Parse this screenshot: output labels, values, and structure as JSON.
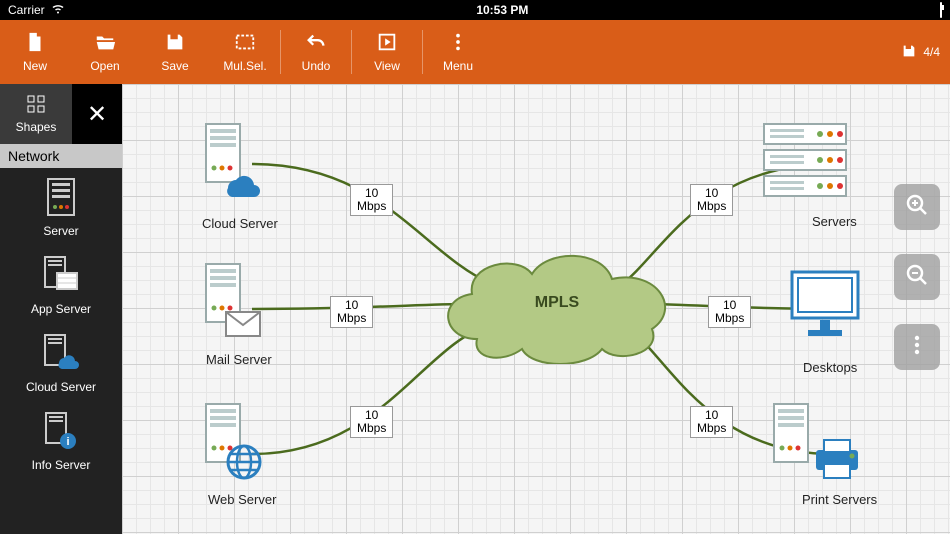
{
  "status": {
    "carrier": "Carrier",
    "time": "10:53 PM"
  },
  "toolbar": {
    "new": "New",
    "open": "Open",
    "save": "Save",
    "mulsel": "Mul.Sel.",
    "undo": "Undo",
    "view": "View",
    "menu": "Menu",
    "page_indicator": "4/4"
  },
  "sidebar": {
    "shapes_label": "Shapes",
    "category": "Network",
    "items": [
      {
        "label": "Server"
      },
      {
        "label": "App Server"
      },
      {
        "label": "Cloud Server"
      },
      {
        "label": "Info Server"
      }
    ]
  },
  "diagram": {
    "center_label": "MPLS",
    "nodes": {
      "cloud_server": "Cloud Server",
      "mail_server": "Mail Server",
      "web_server": "Web Server",
      "servers": "Servers",
      "desktops": "Desktops",
      "print_servers": "Print Servers"
    },
    "rates": {
      "r1": "10\nMbps",
      "r2": "10\nMbps",
      "r3": "10\nMbps",
      "r4": "10\nMbps",
      "r5": "10\nMbps",
      "r6": "10\nMbps"
    }
  }
}
